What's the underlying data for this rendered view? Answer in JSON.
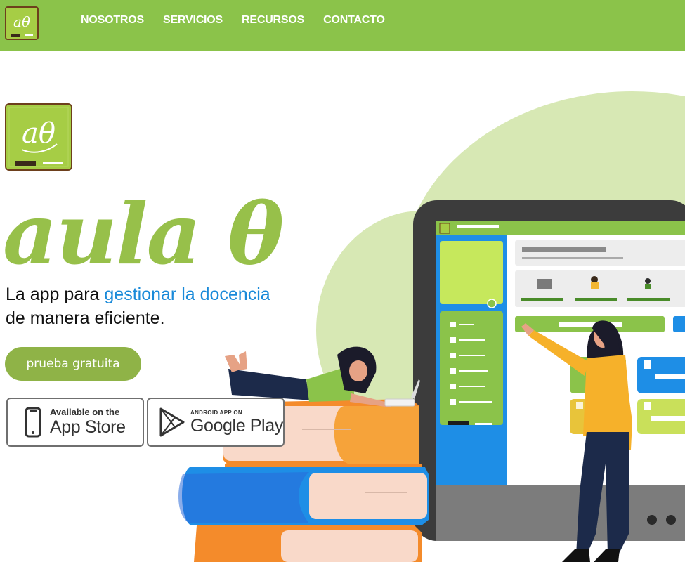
{
  "nav": {
    "items": [
      {
        "label": "NOSOTROS"
      },
      {
        "label": "SERVICIOS"
      },
      {
        "label": "RECURSOS"
      },
      {
        "label": "CONTACTO"
      }
    ]
  },
  "logo": {
    "mark": "aθ"
  },
  "hero": {
    "wordmark": "aula θ",
    "tagline": {
      "part1": "La app para ",
      "accent": "gestionar la docencia",
      "part2": " de manera eficiente."
    },
    "cta_label": "prueba gratuita",
    "app_store": {
      "small": "Available on the",
      "big": "App Store"
    },
    "google_play": {
      "small": "ANDROID APP ON",
      "big": "Google Play"
    }
  },
  "colors": {
    "nav_green": "#8bc34a",
    "brand_green": "#8fb347",
    "accent_blue": "#1a8ad9",
    "logo_border": "#6d3f1c"
  }
}
